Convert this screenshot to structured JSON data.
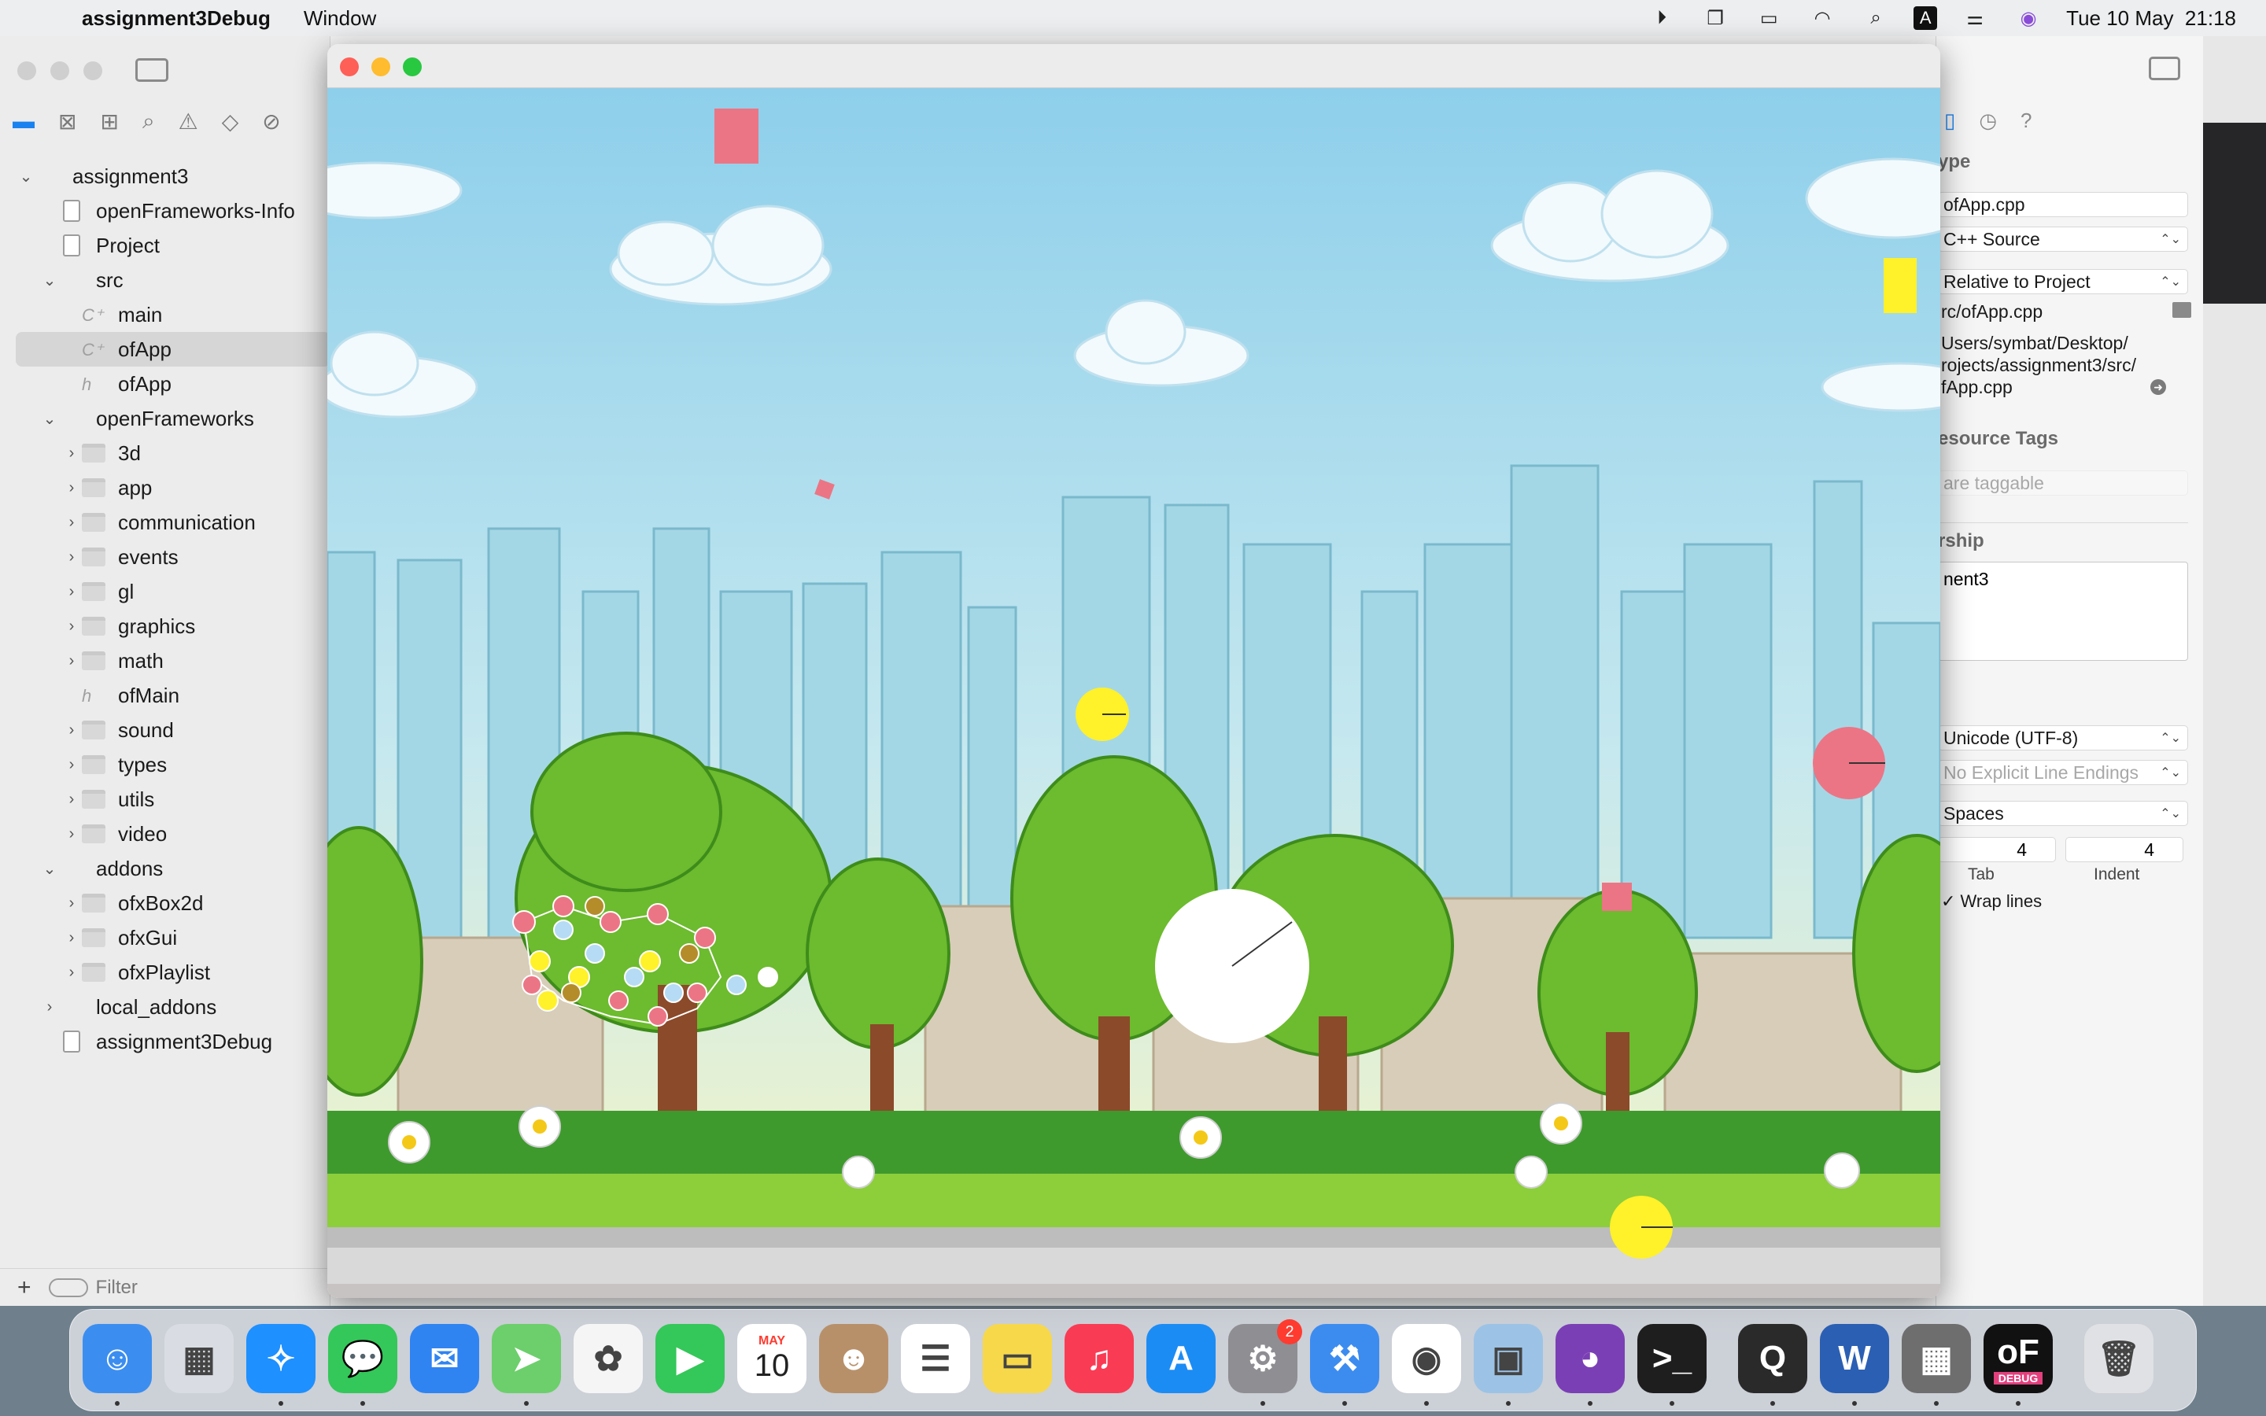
{
  "menubar": {
    "app_name": "assignment3Debug",
    "menu_window": "Window",
    "datetime": "Tue 10 May  21:18",
    "status_icons": [
      "play-circle-icon",
      "screen-mirror-icon",
      "battery-icon",
      "wifi-icon",
      "spotlight-search-icon",
      "input-source-icon",
      "control-center-icon",
      "siri-icon"
    ],
    "input_source_letter": "A"
  },
  "navigator": {
    "items": [
      {
        "label": "assignment3",
        "icon": "project",
        "level": 0,
        "chevron": "open"
      },
      {
        "label": "openFrameworks-Info",
        "icon": "doc",
        "level": 1,
        "chevron": ""
      },
      {
        "label": "Project",
        "icon": "doc",
        "level": 1,
        "chevron": ""
      },
      {
        "label": "src",
        "icon": "none",
        "level": 1,
        "chevron": "open"
      },
      {
        "label": "main",
        "icon": "cpp",
        "level": 2,
        "chevron": ""
      },
      {
        "label": "ofApp",
        "icon": "cpp",
        "level": 2,
        "chevron": "",
        "selected": true
      },
      {
        "label": "ofApp",
        "icon": "h",
        "level": 2,
        "chevron": ""
      },
      {
        "label": "openFrameworks",
        "icon": "none",
        "level": 1,
        "chevron": "open"
      },
      {
        "label": "3d",
        "icon": "folder",
        "level": 2,
        "chevron": "closed"
      },
      {
        "label": "app",
        "icon": "folder",
        "level": 2,
        "chevron": "closed"
      },
      {
        "label": "communication",
        "icon": "folder",
        "level": 2,
        "chevron": "closed"
      },
      {
        "label": "events",
        "icon": "folder",
        "level": 2,
        "chevron": "closed"
      },
      {
        "label": "gl",
        "icon": "folder",
        "level": 2,
        "chevron": "closed"
      },
      {
        "label": "graphics",
        "icon": "folder",
        "level": 2,
        "chevron": "closed"
      },
      {
        "label": "math",
        "icon": "folder",
        "level": 2,
        "chevron": "closed"
      },
      {
        "label": "ofMain",
        "icon": "h",
        "level": 2,
        "chevron": ""
      },
      {
        "label": "sound",
        "icon": "folder",
        "level": 2,
        "chevron": "closed"
      },
      {
        "label": "types",
        "icon": "folder",
        "level": 2,
        "chevron": "closed"
      },
      {
        "label": "utils",
        "icon": "folder",
        "level": 2,
        "chevron": "closed"
      },
      {
        "label": "video",
        "icon": "folder",
        "level": 2,
        "chevron": "closed"
      },
      {
        "label": "addons",
        "icon": "none",
        "level": 1,
        "chevron": "open"
      },
      {
        "label": "ofxBox2d",
        "icon": "folder",
        "level": 2,
        "chevron": "closed"
      },
      {
        "label": "ofxGui",
        "icon": "folder",
        "level": 2,
        "chevron": "closed"
      },
      {
        "label": "ofxPlaylist",
        "icon": "folder",
        "level": 2,
        "chevron": "closed"
      },
      {
        "label": "local_addons",
        "icon": "none",
        "level": 1,
        "chevron": "closed"
      },
      {
        "label": "assignment3Debug",
        "icon": "doc",
        "level": 1,
        "chevron": ""
      }
    ],
    "filter_placeholder": "Filter"
  },
  "inspector": {
    "type_heading": "ype",
    "file_name": "ofApp.cpp",
    "file_type": "C++ Source",
    "location": "Relative to Project",
    "relative_path": "rc/ofApp.cpp",
    "full_path_1": "Users/symbat/Desktop/",
    "full_path_2": "rojects/assignment3/src/",
    "full_path_3": "fApp.cpp",
    "tags_heading": "esource Tags",
    "tags_placeholder": "are taggable",
    "membership_heading": "rship",
    "membership_target": "nent3",
    "encoding": "Unicode (UTF-8)",
    "line_endings": "No Explicit Line Endings",
    "indent_using": "Spaces",
    "tab_value": "4",
    "indent_value": "4",
    "tab_label": "Tab",
    "indent_label": "Indent",
    "wrap_lines": "Wrap lines"
  },
  "dock": {
    "apps": [
      {
        "name": "finder-icon",
        "color": "#3b8ef0",
        "glyph": "☺"
      },
      {
        "name": "launchpad-icon",
        "color": "#d9dde3",
        "glyph": "▦"
      },
      {
        "name": "safari-icon",
        "color": "#1e90ff",
        "glyph": "✧"
      },
      {
        "name": "messages-icon",
        "color": "#34c759",
        "glyph": "💬"
      },
      {
        "name": "mail-icon",
        "color": "#2f84f2",
        "glyph": "✉"
      },
      {
        "name": "maps-icon",
        "color": "#6ccf6b",
        "glyph": "➤"
      },
      {
        "name": "photos-icon",
        "color": "#f5f5f5",
        "glyph": "✿"
      },
      {
        "name": "facetime-icon",
        "color": "#34c759",
        "glyph": "▶"
      },
      {
        "name": "calendar-icon",
        "color": "#ffffff",
        "glyph": "10"
      },
      {
        "name": "contacts-icon",
        "color": "#b7906a",
        "glyph": "☻"
      },
      {
        "name": "reminders-icon",
        "color": "#ffffff",
        "glyph": "☰"
      },
      {
        "name": "notes-icon",
        "color": "#f7d84a",
        "glyph": "▭"
      },
      {
        "name": "music-icon",
        "color": "#fa3b54",
        "glyph": "♫"
      },
      {
        "name": "app-store-icon",
        "color": "#1c8cf5",
        "glyph": "A"
      },
      {
        "name": "system-preferences-icon",
        "color": "#8e8e93",
        "glyph": "⚙",
        "badge": "2"
      },
      {
        "name": "xcode-icon",
        "color": "#3c8cf0",
        "glyph": "⚒"
      },
      {
        "name": "chrome-icon",
        "color": "#ffffff",
        "glyph": "◉"
      },
      {
        "name": "preview-icon",
        "color": "#9cc3e6",
        "glyph": "▣"
      },
      {
        "name": "github-desktop-icon",
        "color": "#7b3fb5",
        "glyph": "◕"
      },
      {
        "name": "terminal-icon",
        "color": "#1e1e1e",
        "glyph": ">_"
      },
      {
        "name": "quicktime-icon",
        "color": "#2a2a2a",
        "glyph": "Q"
      },
      {
        "name": "word-icon",
        "color": "#2b5fb3",
        "glyph": "W"
      },
      {
        "name": "calculator-icon",
        "color": "#6e6e6e",
        "glyph": "▦"
      },
      {
        "name": "openframeworks-debug-icon",
        "color": "#111111",
        "glyph": "oF"
      },
      {
        "name": "trash-icon",
        "color": "#dfe1e4",
        "glyph": "🗑"
      }
    ],
    "calendar_month": "MAY",
    "calendar_day": "10",
    "debug_label": "DEBUG"
  },
  "colors": {
    "sky_top": "#8ecfeb",
    "sky_bottom": "#f8f6c4",
    "grass": "#8ccf3a",
    "pink": "#ec7585",
    "yellow": "#fff12a",
    "close": "#fe5f57",
    "minimize": "#febc2e",
    "zoom": "#28c840"
  }
}
